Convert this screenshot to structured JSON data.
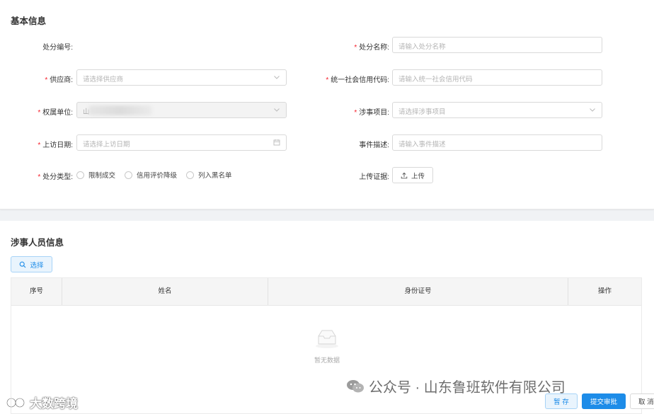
{
  "basic_info": {
    "title": "基本信息",
    "fields": {
      "penalty_no": {
        "label": "处分编号:"
      },
      "penalty_name": {
        "label": "处分名称:",
        "required": true,
        "placeholder": "请输入处分名称"
      },
      "supplier": {
        "label": "供应商:",
        "required": true,
        "placeholder": "请选择供应商"
      },
      "credit_code": {
        "label": "统一社会信用代码:",
        "required": true,
        "placeholder": "请输入统一社会信用代码"
      },
      "unit": {
        "label": "权属单位:",
        "required": true,
        "value": "山"
      },
      "project": {
        "label": "涉事项目:",
        "required": true,
        "placeholder": "请选择涉事项目"
      },
      "visit_date": {
        "label": "上访日期:",
        "required": true,
        "placeholder": "请选择上访日期"
      },
      "event_desc": {
        "label": "事件描述:",
        "placeholder": "请输入事件描述"
      },
      "penalty_type": {
        "label": "处分类型:",
        "required": true,
        "options": [
          "限制成交",
          "信用评价降级",
          "列入黑名单"
        ]
      },
      "evidence": {
        "label": "上传证据:",
        "button": "上传"
      }
    },
    "required_mark": "*"
  },
  "people_info": {
    "title": "涉事人员信息",
    "select_button": "选择",
    "table": {
      "columns": [
        "序号",
        "姓名",
        "身份证号",
        "操作"
      ],
      "rows": [],
      "empty_text": "暂无数据"
    }
  },
  "footer": {
    "save": "暂 存",
    "submit": "提交审批",
    "cancel": "取 消"
  },
  "watermarks": {
    "left": "大数跨境",
    "right": "公众号 · 山东鲁班软件有限公司"
  },
  "colors": {
    "primary": "#1d8ce8",
    "required": "#f5222d",
    "border": "#d9d9d9"
  }
}
